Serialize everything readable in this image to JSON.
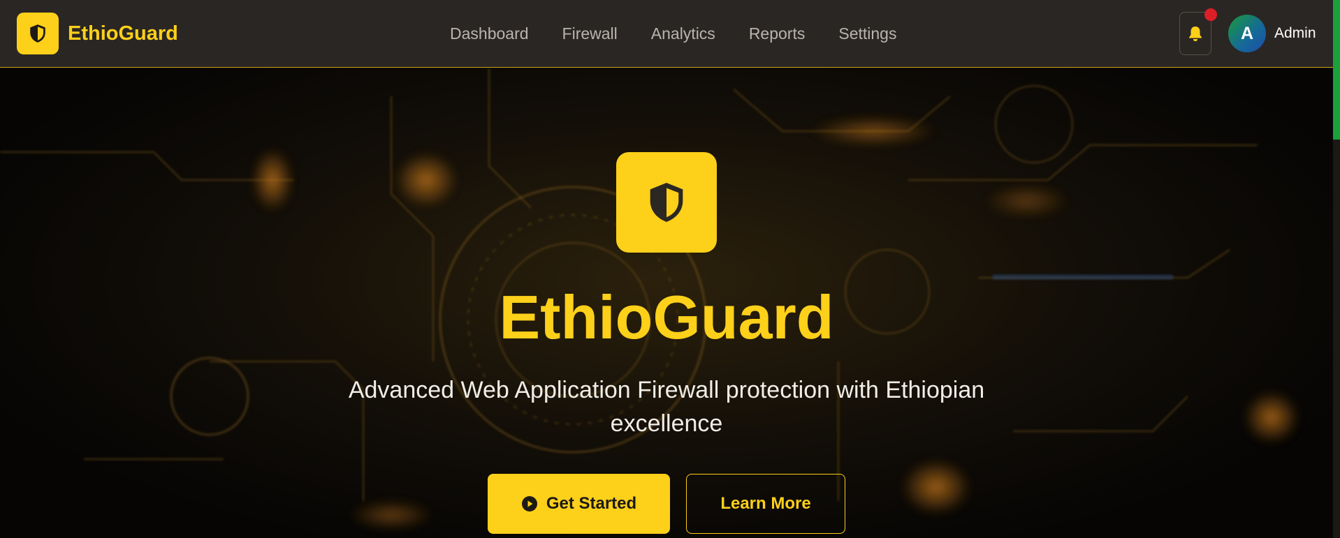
{
  "brand": {
    "name": "EthioGuard",
    "logo_icon": "shield-icon"
  },
  "nav": {
    "items": [
      {
        "label": "Dashboard"
      },
      {
        "label": "Firewall"
      },
      {
        "label": "Analytics"
      },
      {
        "label": "Reports"
      },
      {
        "label": "Settings"
      }
    ]
  },
  "header": {
    "notification_icon": "bell-icon",
    "has_unread": true,
    "user": {
      "initial": "A",
      "name": "Admin"
    }
  },
  "hero": {
    "icon": "shield-icon",
    "title": "EthioGuard",
    "subtitle": "Advanced Web Application Firewall protection with Ethiopian excellence",
    "primary_button": {
      "label": "Get Started",
      "icon": "play-circle-icon"
    },
    "secondary_button": {
      "label": "Learn More"
    }
  },
  "colors": {
    "accent": "#fdd01a",
    "header_bg": "#2a2623",
    "notification_dot": "#dc1f26",
    "scrollbar": "#1aa13c"
  }
}
